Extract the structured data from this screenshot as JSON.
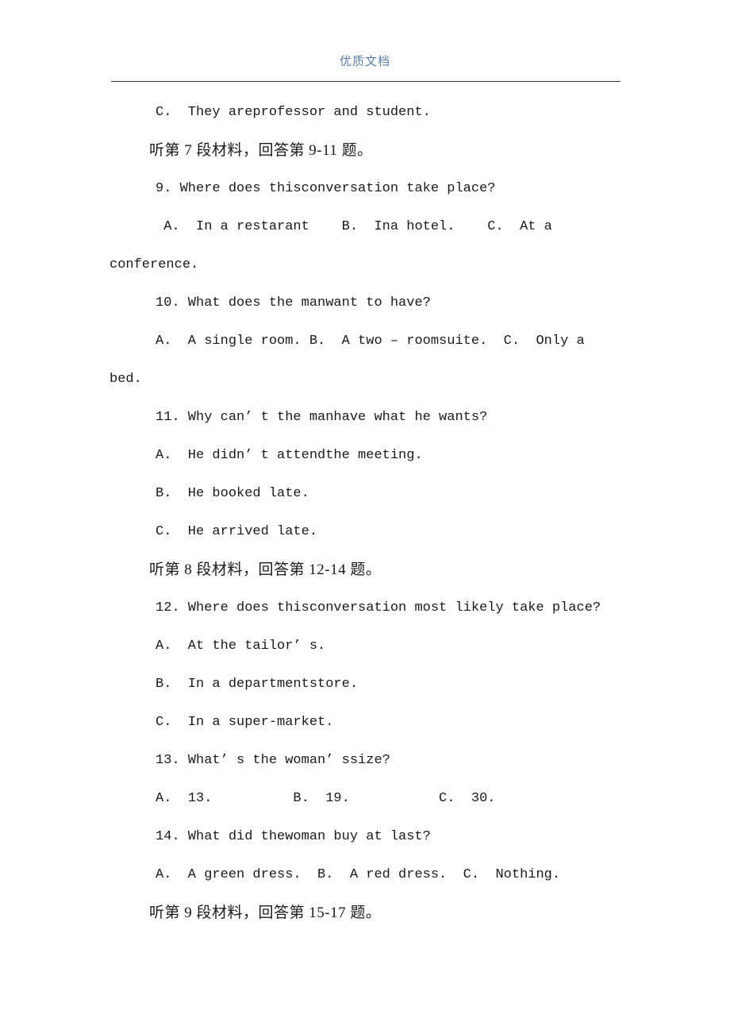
{
  "header": {
    "watermark": "优质文档",
    "watermark_color": "#5b7fa6",
    "rule_color": "#3a3a3a"
  },
  "document": {
    "lines": [
      {
        "id": "l01",
        "kind": "option",
        "indent": true,
        "script": "latin",
        "text": "C.  They areprofessor and student."
      },
      {
        "id": "l02",
        "kind": "direction",
        "indent": true,
        "script": "chinese",
        "text": "听第 7 段材料，回答第 9-11 题。"
      },
      {
        "id": "l03",
        "kind": "question",
        "indent": true,
        "script": "latin",
        "text": "9. Where does thisconversation take place?"
      },
      {
        "id": "l04",
        "kind": "option",
        "indent": true,
        "script": "latin",
        "text": " A.  In a restarant    B.  Ina hotel.    C.  At a"
      },
      {
        "id": "l05",
        "kind": "wrap",
        "indent": false,
        "script": "latin",
        "text": "conference."
      },
      {
        "id": "l06",
        "kind": "question",
        "indent": true,
        "script": "latin",
        "text": "10. What does the manwant to have?"
      },
      {
        "id": "l07",
        "kind": "option",
        "indent": true,
        "script": "latin",
        "text": "A.  A single room. B.  A two – roomsuite.  C.  Only a"
      },
      {
        "id": "l08",
        "kind": "wrap",
        "indent": false,
        "script": "latin",
        "text": "bed."
      },
      {
        "id": "l09",
        "kind": "question",
        "indent": true,
        "script": "latin",
        "text": "11. Why can’ t the manhave what he wants?"
      },
      {
        "id": "l10",
        "kind": "option",
        "indent": true,
        "script": "latin",
        "text": "A.  He didn’ t attendthe meeting."
      },
      {
        "id": "l11",
        "kind": "option",
        "indent": true,
        "script": "latin",
        "text": "B.  He booked late."
      },
      {
        "id": "l12",
        "kind": "option",
        "indent": true,
        "script": "latin",
        "text": "C.  He arrived late."
      },
      {
        "id": "l13",
        "kind": "direction",
        "indent": true,
        "script": "chinese",
        "text": "听第 8 段材料，回答第 12-14 题。"
      },
      {
        "id": "l14",
        "kind": "question",
        "indent": true,
        "script": "latin",
        "text": "12. Where does thisconversation most likely take place?"
      },
      {
        "id": "l15",
        "kind": "option",
        "indent": true,
        "script": "latin",
        "text": "A.  At the tailor’ s."
      },
      {
        "id": "l16",
        "kind": "option",
        "indent": true,
        "script": "latin",
        "text": "B.  In a departmentstore."
      },
      {
        "id": "l17",
        "kind": "option",
        "indent": true,
        "script": "latin",
        "text": "C.  In a super-market."
      },
      {
        "id": "l18",
        "kind": "question",
        "indent": true,
        "script": "latin",
        "text": "13. What’ s the woman’ ssize?"
      },
      {
        "id": "l19",
        "kind": "option",
        "indent": true,
        "script": "latin",
        "text": "A.  13.          B.  19.           C.  30."
      },
      {
        "id": "l20",
        "kind": "question",
        "indent": true,
        "script": "latin",
        "text": "14. What did thewoman buy at last?"
      },
      {
        "id": "l21",
        "kind": "option",
        "indent": true,
        "script": "latin",
        "text": "A.  A green dress.  B.  A red dress.  C.  Nothing."
      },
      {
        "id": "l22",
        "kind": "direction",
        "indent": true,
        "script": "chinese",
        "text": "听第 9 段材料，回答第 15-17 题。"
      }
    ]
  }
}
